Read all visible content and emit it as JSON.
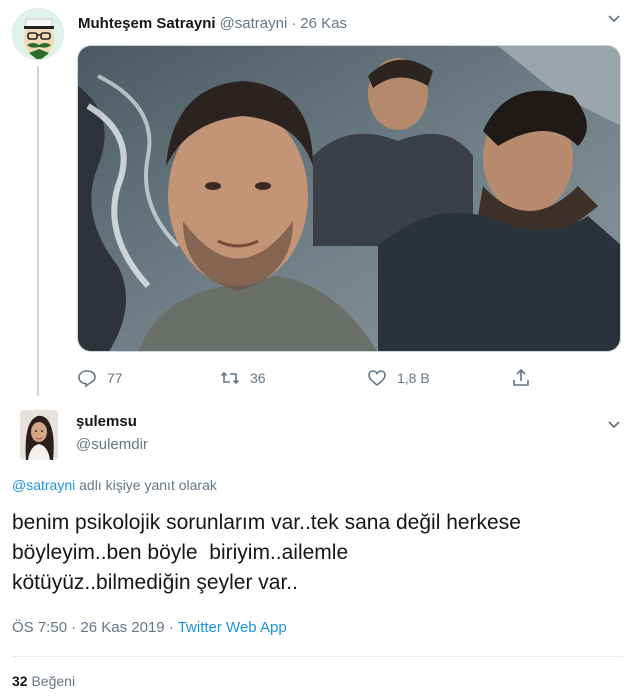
{
  "parent_tweet": {
    "display_name": "Muhteşem Satrayni",
    "handle": "@satrayni",
    "separator": "·",
    "date": "26 Kas",
    "icons": {
      "avatar": "mustache-avatar-icon",
      "menu": "chevron-down-icon"
    },
    "actions": {
      "reply_count": "77",
      "retweet_count": "36",
      "like_count": "1,8 B"
    }
  },
  "reply_tweet": {
    "display_name": "şulemsu",
    "handle": "@sulemdir",
    "replying_to_mention": "@satrayni",
    "replying_to_suffix": " adlı kişiye yanıt olarak",
    "text_line_1": "benim psikolojik sorunlarım var..tek sana değil herkese",
    "text_line_2": "böyleyim..ben böyle  biriyim..ailemle",
    "text_line_3": "kötüyüz..bilmediğin şeyler var..",
    "time": "ÖS 7:50",
    "separator": "·",
    "date": "26 Kas 2019",
    "source": "Twitter Web App",
    "likes_count": "32",
    "likes_label": "Beğeni"
  },
  "colors": {
    "link_blue": "#1b95e0",
    "muted_gray": "#657786",
    "text_dark": "#14171a",
    "thread_line": "#ccd6dd"
  }
}
